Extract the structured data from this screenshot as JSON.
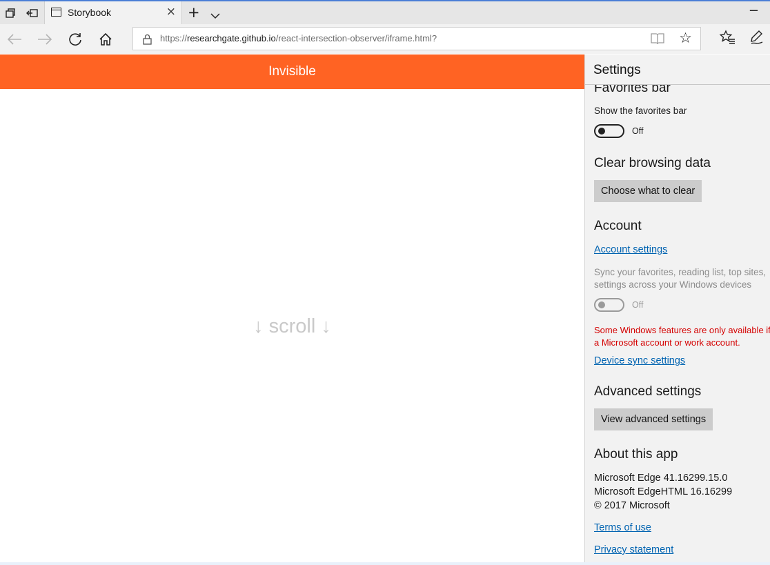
{
  "browser": {
    "tab_title": "Storybook",
    "tab_close": "×",
    "new_tab": "+",
    "url_prefix": "https://",
    "url_domain": "researchgate.github.io",
    "url_path": "/react-intersection-observer/iframe.html?",
    "minimize": "−",
    "favorite_star": "☆",
    "accent_color": "#4a7ed6"
  },
  "page": {
    "banner_text": "Invisible",
    "banner_color": "#ff6323",
    "scroll_hint": "↓ scroll ↓"
  },
  "settings": {
    "title": "Settings",
    "favorites_heading": "Favorites bar",
    "show_favorites_label": "Show the favorites bar",
    "favorites_toggle_state": "Off",
    "clear_heading": "Clear browsing data",
    "clear_button": "Choose what to clear",
    "account_heading": "Account",
    "account_link": "Account settings",
    "sync_text_1": "Sync your favorites, reading list, top sites,",
    "sync_text_2": "settings across your Windows devices",
    "sync_toggle_state": "Off",
    "warning_1": "Some Windows features are only available if",
    "warning_2": "a Microsoft account or work account.",
    "device_sync_link": "Device sync settings",
    "advanced_heading": "Advanced settings",
    "advanced_button": "View advanced settings",
    "about_heading": "About this app",
    "about_line_1": "Microsoft Edge 41.16299.15.0",
    "about_line_2": "Microsoft EdgeHTML 16.16299",
    "about_line_3": "© 2017 Microsoft",
    "terms_link": "Terms of use",
    "privacy_link": "Privacy statement"
  }
}
